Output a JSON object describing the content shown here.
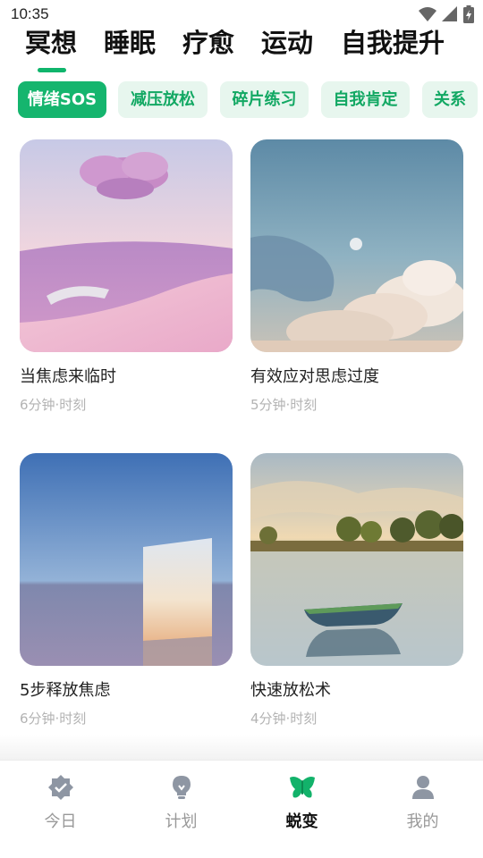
{
  "status_bar": {
    "time": "10:35",
    "icons": [
      "wifi-icon",
      "signal-icon",
      "battery-icon"
    ]
  },
  "main_tabs": [
    {
      "label": "冥想",
      "active": true
    },
    {
      "label": "睡眠",
      "active": false
    },
    {
      "label": "疗愈",
      "active": false
    },
    {
      "label": "运动",
      "active": false
    },
    {
      "label": "自我提升",
      "active": false
    }
  ],
  "chips": [
    {
      "label": "情绪SOS",
      "active": true
    },
    {
      "label": "减压放松",
      "active": false
    },
    {
      "label": "碎片练习",
      "active": false
    },
    {
      "label": "自我肯定",
      "active": false
    },
    {
      "label": "关系",
      "active": false
    }
  ],
  "cards": [
    {
      "title": "当焦虑来临时",
      "meta": "6分钟·时刻",
      "image": "lavender-field-cloud"
    },
    {
      "title": "有效应对思虑过度",
      "meta": "5分钟·时刻",
      "image": "clouds-moon-sky"
    },
    {
      "title": "5步释放焦虑",
      "meta": "6分钟·时刻",
      "image": "mirror-door-sea"
    },
    {
      "title": "快速放松术",
      "meta": "4分钟·时刻",
      "image": "boat-lake-trees"
    }
  ],
  "bottom_nav": [
    {
      "label": "今日",
      "icon": "badge-check-icon",
      "active": false
    },
    {
      "label": "计划",
      "icon": "lightbulb-icon",
      "active": false
    },
    {
      "label": "蜕变",
      "icon": "butterfly-icon",
      "active": true
    },
    {
      "label": "我的",
      "icon": "person-icon",
      "active": false
    }
  ],
  "colors": {
    "accent": "#15b56e",
    "chip_bg": "#e7f6ee",
    "chip_text": "#12a863",
    "muted_text": "#b3b3b3"
  }
}
